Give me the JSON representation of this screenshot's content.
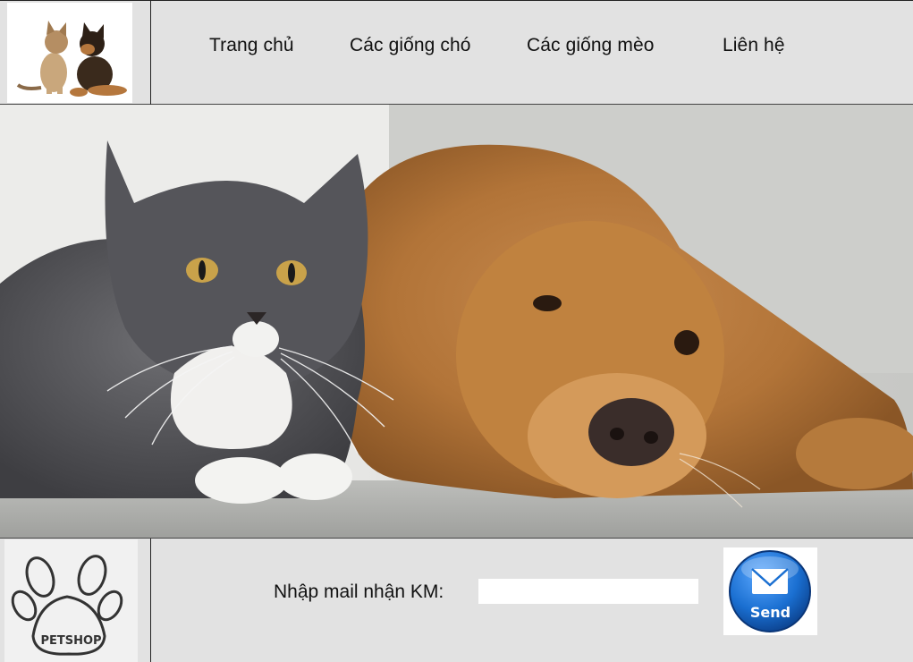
{
  "header": {
    "logo_icon": "cat-and-dog-logo",
    "nav": [
      {
        "label": "Trang chủ"
      },
      {
        "label": "Các giống chó"
      },
      {
        "label": "Các giống mèo"
      },
      {
        "label": "Liên hệ"
      }
    ]
  },
  "hero": {
    "image": "cat-and-golden-retriever-photo"
  },
  "footer": {
    "brand_logo_text": "PETSHOP",
    "mail_label": "Nhập mail nhận KM:",
    "mail_input_value": "",
    "send_label": "Send",
    "send_icon": "envelope-icon"
  },
  "colors": {
    "bar_background": "#e2e2e2",
    "send_blue": "#1a6fd1"
  }
}
